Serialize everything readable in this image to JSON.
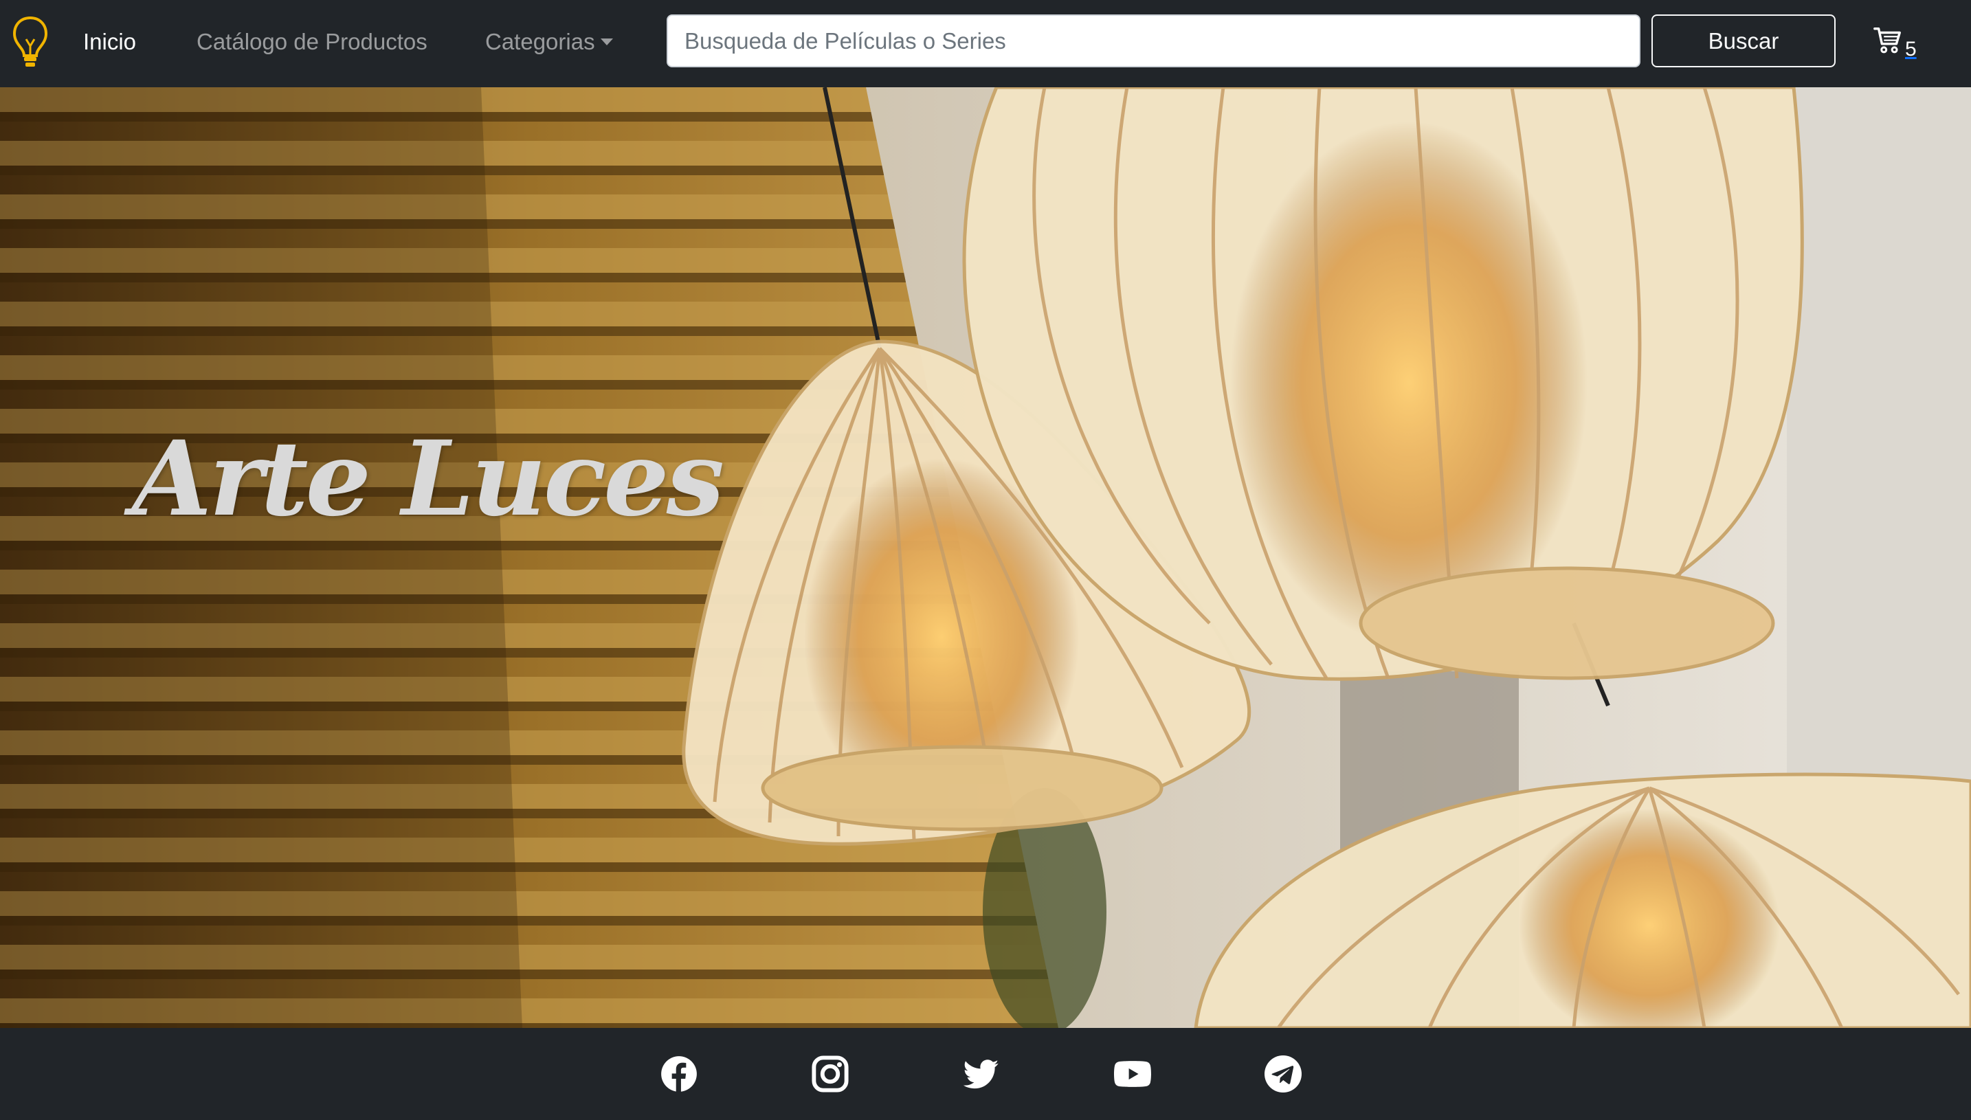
{
  "nav": {
    "brand_icon": "lightbulb-icon",
    "links": [
      {
        "label": "Inicio",
        "active": true
      },
      {
        "label": "Catálogo de Productos",
        "active": false
      },
      {
        "label": "Categorias",
        "active": false,
        "dropdown": true
      }
    ],
    "search": {
      "value": "",
      "placeholder": "Busqueda de Películas o Series"
    },
    "search_button_label": "Buscar",
    "cart": {
      "icon": "shopping-cart-icon",
      "count": "5"
    }
  },
  "hero": {
    "title": "Arte Luces",
    "image": "rattan pendant lamps over wooden slat wall"
  },
  "footer": {
    "social": [
      {
        "name": "facebook-icon"
      },
      {
        "name": "instagram-icon"
      },
      {
        "name": "twitter-icon"
      },
      {
        "name": "youtube-icon"
      },
      {
        "name": "telegram-icon"
      }
    ]
  },
  "colors": {
    "navbar_bg": "#212529",
    "brand_accent": "#f0b400",
    "nav_inactive": "#8c8e91",
    "nav_active": "#ffffff",
    "cart_underline": "#0d6efd"
  }
}
